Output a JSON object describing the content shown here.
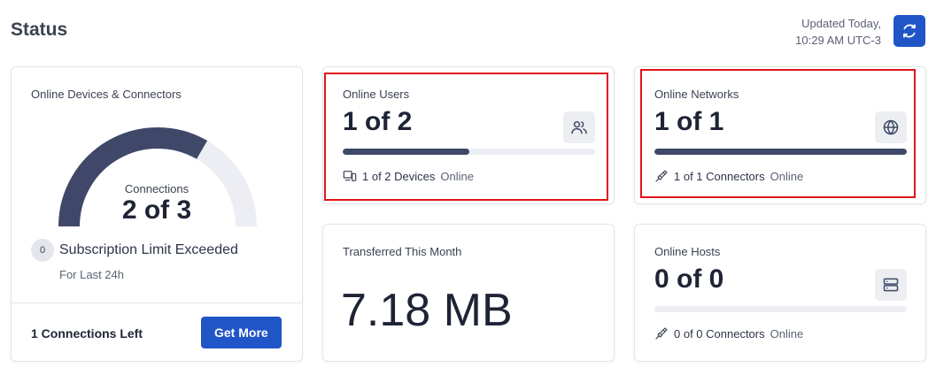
{
  "header": {
    "title": "Status",
    "updated_line1": "Updated Today,",
    "updated_line2": "10:29 AM UTC-3",
    "refresh_icon": "refresh-icon",
    "accent": "#1f55c7"
  },
  "devices_card": {
    "label": "Online Devices & Connectors",
    "gauge_label": "Connections",
    "gauge_value": "2 of 3",
    "gauge_fraction": 0.667,
    "badge": "0",
    "limit_text": "Subscription Limit Exceeded",
    "period_text": "For Last 24h",
    "connections_left": "1 Connections Left",
    "get_more_label": "Get More"
  },
  "users_card": {
    "label": "Online Users",
    "value": "1 of 2",
    "progress_percent": 50,
    "icon": "users-icon",
    "footer_icon": "devices-icon",
    "footer_count": "1 of 2 Devices",
    "footer_status": "Online"
  },
  "networks_card": {
    "label": "Online Networks",
    "value": "1 of 1",
    "progress_percent": 100,
    "icon": "globe-icon",
    "footer_icon": "plug-icon",
    "footer_count": "1 of 1 Connectors",
    "footer_status": "Online"
  },
  "transferred_card": {
    "label": "Transferred This Month",
    "value": "7.18 MB"
  },
  "hosts_card": {
    "label": "Online Hosts",
    "value": "0 of 0",
    "progress_percent": 0,
    "icon": "server-icon",
    "footer_icon": "plug-icon",
    "footer_count": "0 of 0 Connectors",
    "footer_status": "Online"
  },
  "highlight_color": "#e0141b"
}
